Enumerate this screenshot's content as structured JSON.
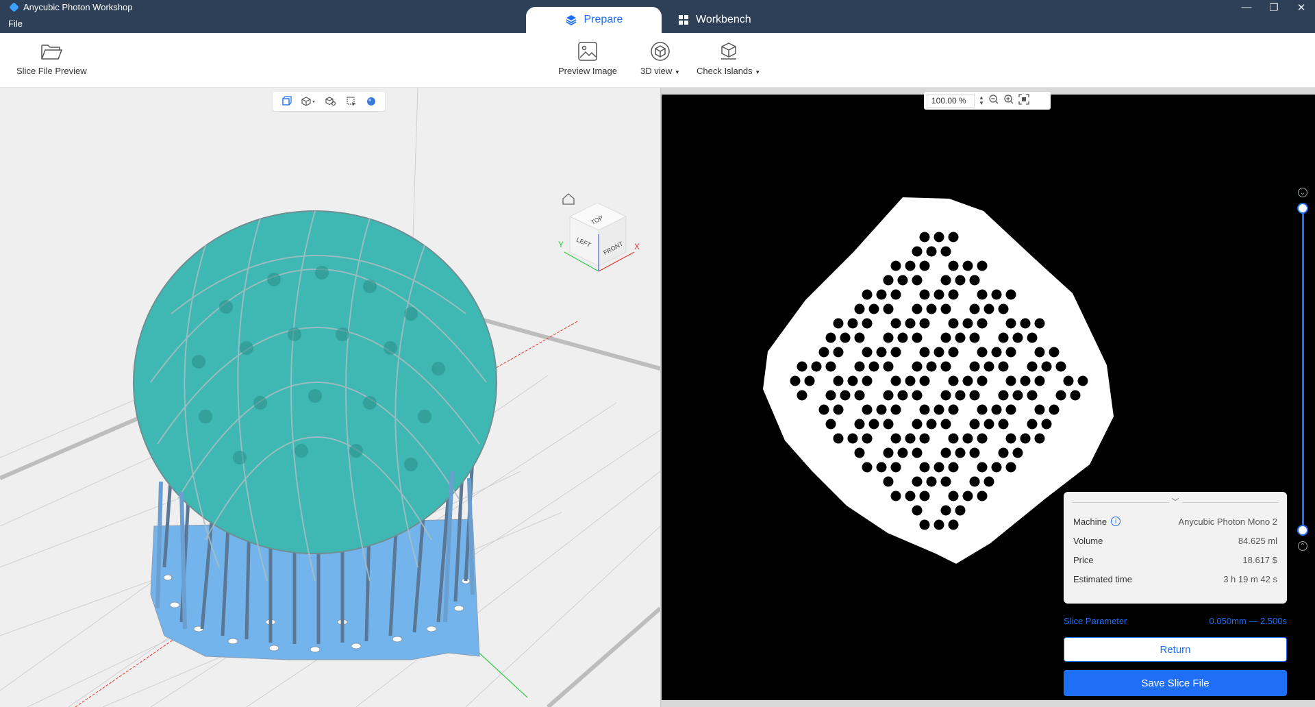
{
  "app": {
    "title": "Anycubic Photon Workshop",
    "menu_file": "File"
  },
  "tabs": {
    "prepare": "Prepare",
    "workbench": "Workbench"
  },
  "window_controls": {
    "minimize": "—",
    "restore": "❐",
    "close": "✕"
  },
  "toolbar": {
    "slice_file_preview": "Slice File Preview",
    "preview_image": "Preview Image",
    "view_3d": "3D view",
    "check_islands": "Check Islands"
  },
  "view_cube": {
    "top": "TOP",
    "left": "LEFT",
    "front": "FRONT",
    "axis_x": "X",
    "axis_y": "Y"
  },
  "zoom": {
    "value": "100.00 %"
  },
  "info": {
    "machine_label": "Machine",
    "machine_value": "Anycubic Photon Mono 2",
    "volume_label": "Volume",
    "volume_value": "84.625 ml",
    "price_label": "Price",
    "price_value": "18.617 $",
    "time_label": "Estimated time",
    "time_value": "3 h 19 m 42 s"
  },
  "slice_parameter": {
    "label": "Slice Parameter",
    "value": "0.050mm — 2.500s"
  },
  "buttons": {
    "return": "Return",
    "save": "Save Slice File"
  },
  "colors": {
    "accent": "#1e6ff5",
    "titlebar": "#2d4057",
    "model_teal": "#3fb7b3",
    "support_blue": "#6aaee6"
  }
}
